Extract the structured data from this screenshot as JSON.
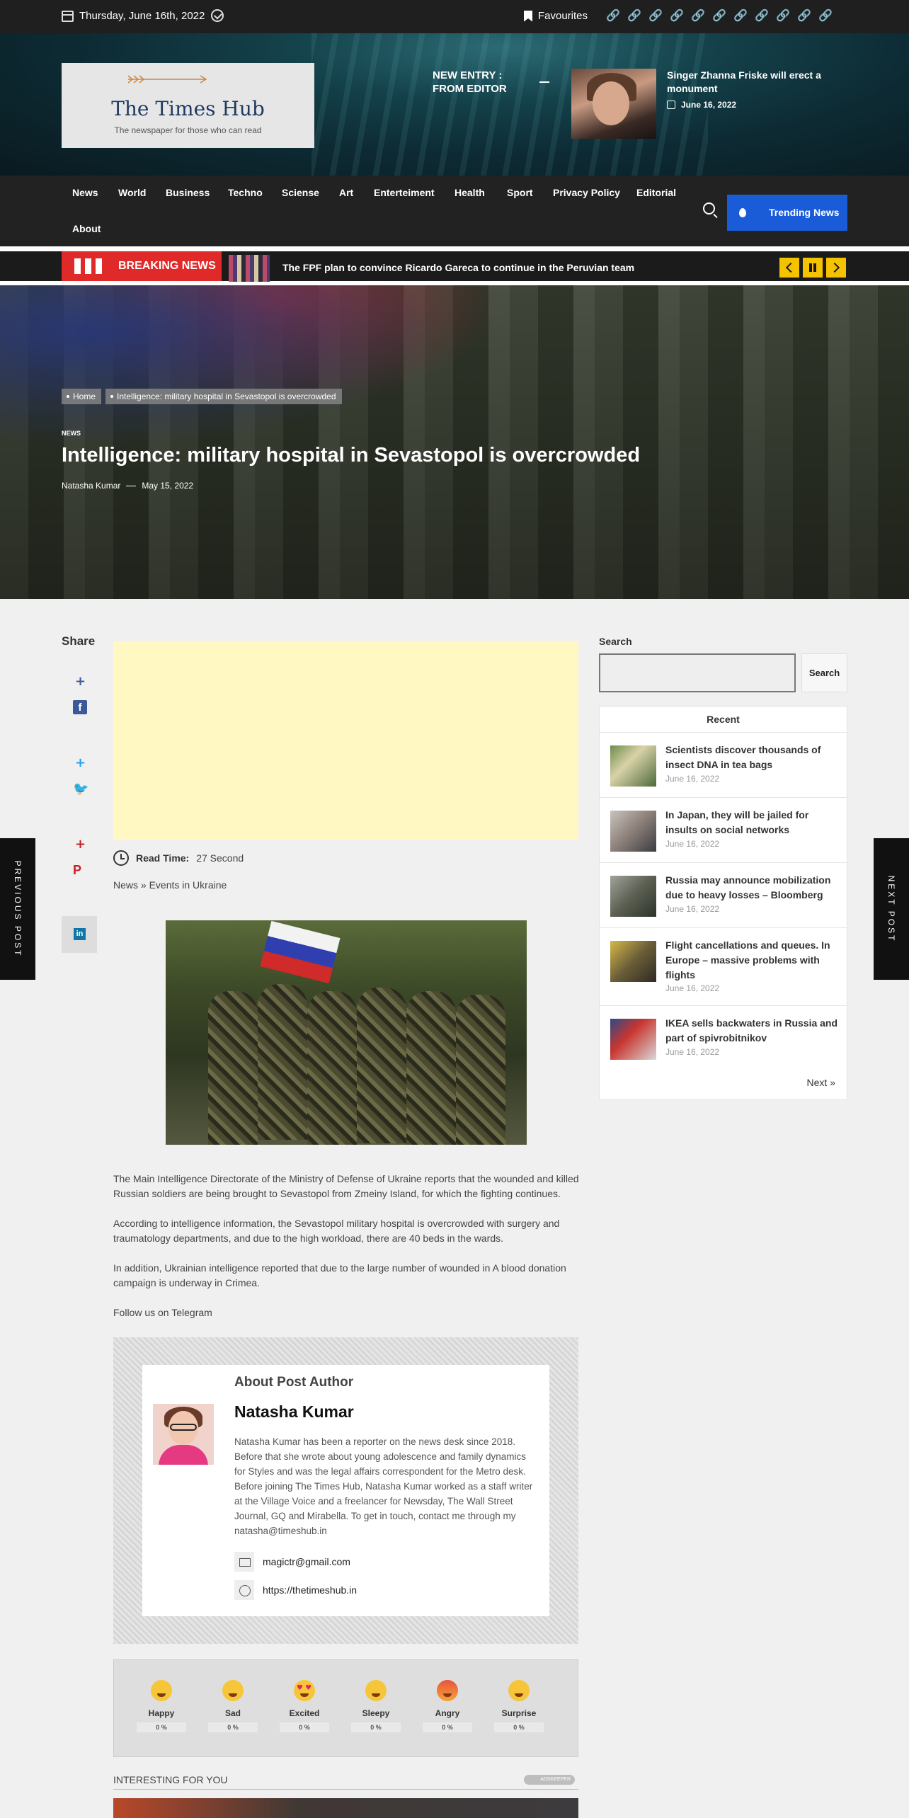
{
  "topbar": {
    "date": "Thursday, June 16th, 2022",
    "favourites": "Favourites",
    "social_icons": [
      "link-icon",
      "link-icon",
      "link-icon",
      "link-icon",
      "link-icon",
      "link-icon",
      "link-icon",
      "link-icon",
      "link-icon",
      "link-icon",
      "link-icon"
    ]
  },
  "logo": {
    "name": "The Times Hub",
    "tagline": "The newspaper for those who can read"
  },
  "editor": {
    "label": "NEW ENTRY : FROM EDITOR",
    "title": "Singer Zhanna Friske will erect a monument",
    "date": "June 16, 2022"
  },
  "nav": {
    "items": [
      "News",
      "World",
      "Business",
      "Techno",
      "Sciense",
      "Art",
      "Enterteiment",
      "Health",
      "Sport",
      "Privacy Policy",
      "Editorial",
      "About"
    ],
    "trending": "Trending News"
  },
  "breaking": {
    "label": "BREAKING NEWS",
    "headline": "The FPF plan to convince Ricardo Gareca to continue in the Peruvian team"
  },
  "hero": {
    "crumbs": [
      "Home",
      "Intelligence: military hospital in Sevastopol is overcrowded"
    ],
    "category": "NEWS",
    "title": "Intelligence: military hospital in Sevastopol is overcrowded",
    "author": "Natasha Kumar",
    "date": "May 15, 2022"
  },
  "sidetabs": {
    "previous": "PREVIOUS POST",
    "next": "NEXT POST"
  },
  "share": {
    "title": "Share"
  },
  "article": {
    "read_time_label": "Read Time:",
    "read_time": "27 Second",
    "breadcrumb": "News » Events in Ukraine",
    "paragraphs": [
      "The Main Intelligence Directorate of the Ministry of Defense of Ukraine reports that the wounded and killed Russian soldiers are being brought to Sevastopol from Zmeiny Island, for which the fighting continues.",
      "According to intelligence information, the Sevastopol military hospital is overcrowded with surgery and traumatology departments, and due to the high workload, there are 40 beds in the wards.",
      "In addition, Ukrainian intelligence reported that due to the large number of wounded in A blood donation campaign is underway in Crimea.",
      "Follow us on Telegram"
    ]
  },
  "author": {
    "heading": "About Post Author",
    "name": "Natasha Kumar",
    "bio": "Natasha Kumar has been a reporter on the news desk since 2018. Before that she wrote about young adolescence and family dynamics for Styles and was the legal affairs correspondent for the Metro desk. Before joining The Times Hub, Natasha Kumar worked as a staff writer at the Village Voice and a freelancer for Newsday, The Wall Street Journal, GQ and Mirabella. To get in touch, contact me through my natasha@timeshub.in",
    "email": "magictr@gmail.com",
    "website": "https://thetimeshub.in"
  },
  "reactions": [
    {
      "label": "Happy",
      "pct": "0 %"
    },
    {
      "label": "Sad",
      "pct": "0 %"
    },
    {
      "label": "Excited",
      "pct": "0 %"
    },
    {
      "label": "Sleepy",
      "pct": "0 %"
    },
    {
      "label": "Angry",
      "pct": "0 %"
    },
    {
      "label": "Surprise",
      "pct": "0 %"
    }
  ],
  "interesting": {
    "title": "INTERESTING FOR YOU",
    "brand": "ADSKEEPER"
  },
  "sidebar": {
    "search_title": "Search",
    "search_button": "Search",
    "recent_title": "Recent",
    "recent": [
      {
        "title": "Scientists discover thousands of insect DNA in tea bags",
        "date": "June 16, 2022"
      },
      {
        "title": "In Japan, they will be jailed for insults on social networks",
        "date": "June 16, 2022"
      },
      {
        "title": "Russia may announce mobilization due to heavy losses – Bloomberg",
        "date": "June 16, 2022"
      },
      {
        "title": "Flight cancellations and queues. In Europe – massive problems with flights",
        "date": "June 16, 2022"
      },
      {
        "title": "IKEA sells backwaters in Russia and part of spivrobitnikov",
        "date": "June 16, 2022"
      }
    ],
    "next": "Next »"
  },
  "colors": {
    "breaking": "#e02a2a",
    "trending": "#1a5bd8",
    "ticker_controls": "#f5c200"
  }
}
